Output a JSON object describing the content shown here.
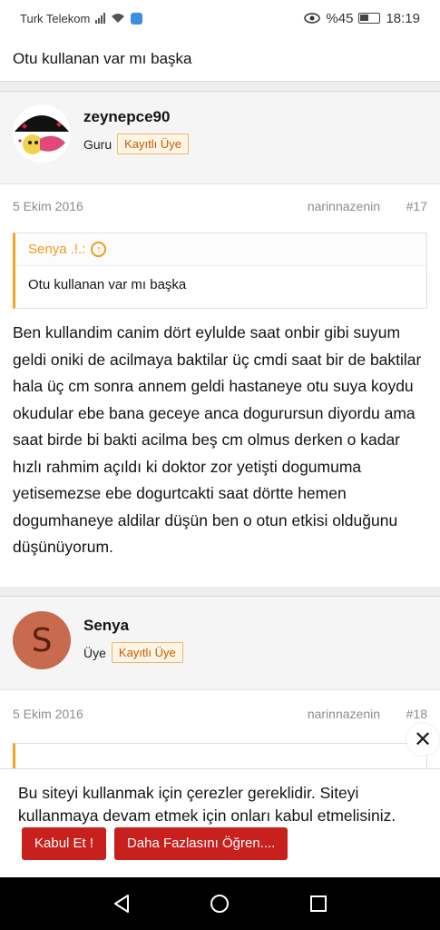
{
  "status_bar": {
    "carrier": "Turk Telekom",
    "battery": "%45",
    "time": "18:19"
  },
  "thread_title": "Otu kullanan var mı başka",
  "posts": [
    {
      "username": "zeynepce90",
      "role": "Guru",
      "badge": "Kayıtlı Üye",
      "date": "5 Ekim 2016",
      "author_tag": "narinnazenin",
      "number": "#17",
      "quote_author": "Senya .!.:",
      "quote_text": "Otu kullanan var mı başka",
      "body": "Ben kullandim canim dört eylulde saat onbir gibi suyum geldi oniki de acilmaya baktilar üç cmdi saat bir de baktilar hala üç cm sonra annem geldi hastaneye otu suya koydu okudular ebe bana geceye anca dogurursun diyordu ama saat birde bi bakti acilma beş cm olmus derken o kadar hızlı rahmim açıldı ki doktor zor yetişti dogumuma yetisemezse ebe dogurtcakti saat dörtte hemen dogumhaneye aldilar düşün ben o otun etkisi olduğunu düşünüyorum."
    },
    {
      "username": "Senya",
      "role": "Üye",
      "badge": "Kayıtlı Üye",
      "avatar_letter": "S",
      "date": "5 Ekim 2016",
      "author_tag": "narinnazenin",
      "number": "#18"
    }
  ],
  "cookie": {
    "text": "Bu siteyi kullanmak için çerezler gereklidir. Siteyi kullanmaya devam etmek için onları kabul etmelisiniz.",
    "accept_label": "Kabul Et !",
    "learn_more_label": "Daha Fazlasını Öğren...."
  },
  "colors": {
    "accent_orange": "#ee9a1c",
    "button_red": "#c8201d",
    "avatar_s": "#c76a4d"
  }
}
